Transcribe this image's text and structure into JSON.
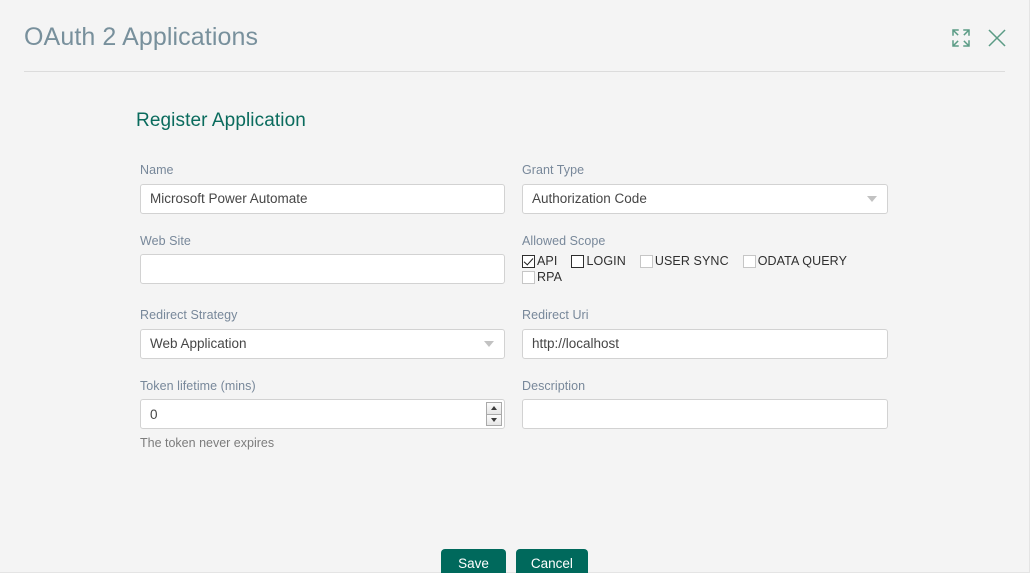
{
  "header": {
    "title": "OAuth 2 Applications",
    "expand_icon": "expand-icon",
    "close_icon": "close-icon",
    "accent_color": "#5b9b85"
  },
  "section": {
    "title": "Register Application",
    "title_color": "#0a6b5d"
  },
  "fields": {
    "name": {
      "label": "Name",
      "value": "Microsoft Power Automate",
      "placeholder": ""
    },
    "grant_type": {
      "label": "Grant Type",
      "value": "Authorization Code"
    },
    "web_site": {
      "label": "Web Site",
      "value": "",
      "placeholder": ""
    },
    "allowed_scope": {
      "label": "Allowed Scope",
      "options": [
        {
          "label": "API",
          "checked": true,
          "dimmed": false
        },
        {
          "label": "LOGIN",
          "checked": false,
          "dimmed": false
        },
        {
          "label": "USER SYNC",
          "checked": false,
          "dimmed": true
        },
        {
          "label": "ODATA QUERY",
          "checked": false,
          "dimmed": true
        },
        {
          "label": "RPA",
          "checked": false,
          "dimmed": true
        }
      ]
    },
    "redirect_strategy": {
      "label": "Redirect Strategy",
      "value": "Web Application"
    },
    "redirect_uri": {
      "label": "Redirect Uri",
      "value": "http://localhost",
      "placeholder": ""
    },
    "token_lifetime": {
      "label": "Token lifetime (mins)",
      "value": "0",
      "placeholder": "",
      "helper": "The token never expires"
    },
    "description": {
      "label": "Description",
      "value": "",
      "placeholder": ""
    }
  },
  "buttons": {
    "save": "Save",
    "cancel": "Cancel",
    "color": "#00695c"
  }
}
